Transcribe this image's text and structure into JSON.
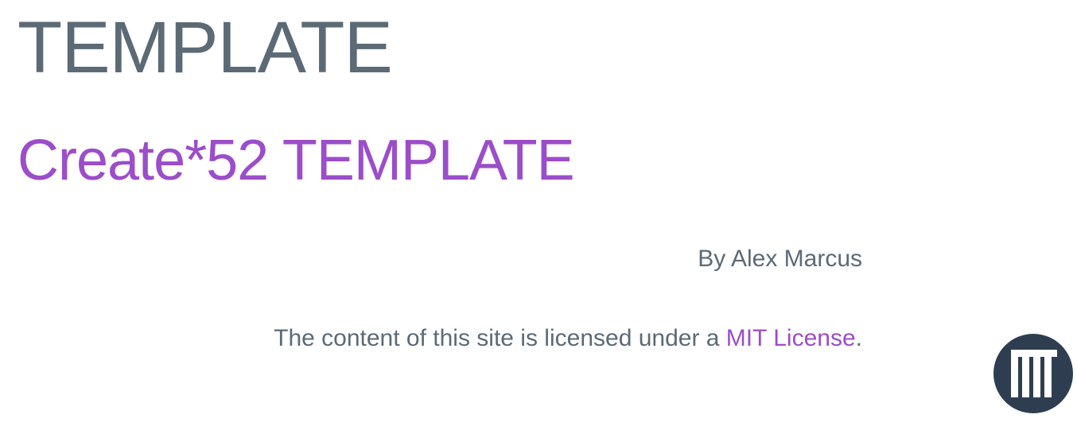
{
  "site": {
    "title": "TEMPLATE"
  },
  "post": {
    "title": "Create*52 TEMPLATE",
    "author": "By Alex Marcus"
  },
  "footer": {
    "license_prefix": "The content of this site is licensed under a ",
    "license_link": "MIT License",
    "license_suffix": ".",
    "badge_icon": "mit-logo-icon"
  },
  "colors": {
    "text": "#5c6a76",
    "accent": "#9b4dca",
    "badge": "#2e3e50"
  }
}
